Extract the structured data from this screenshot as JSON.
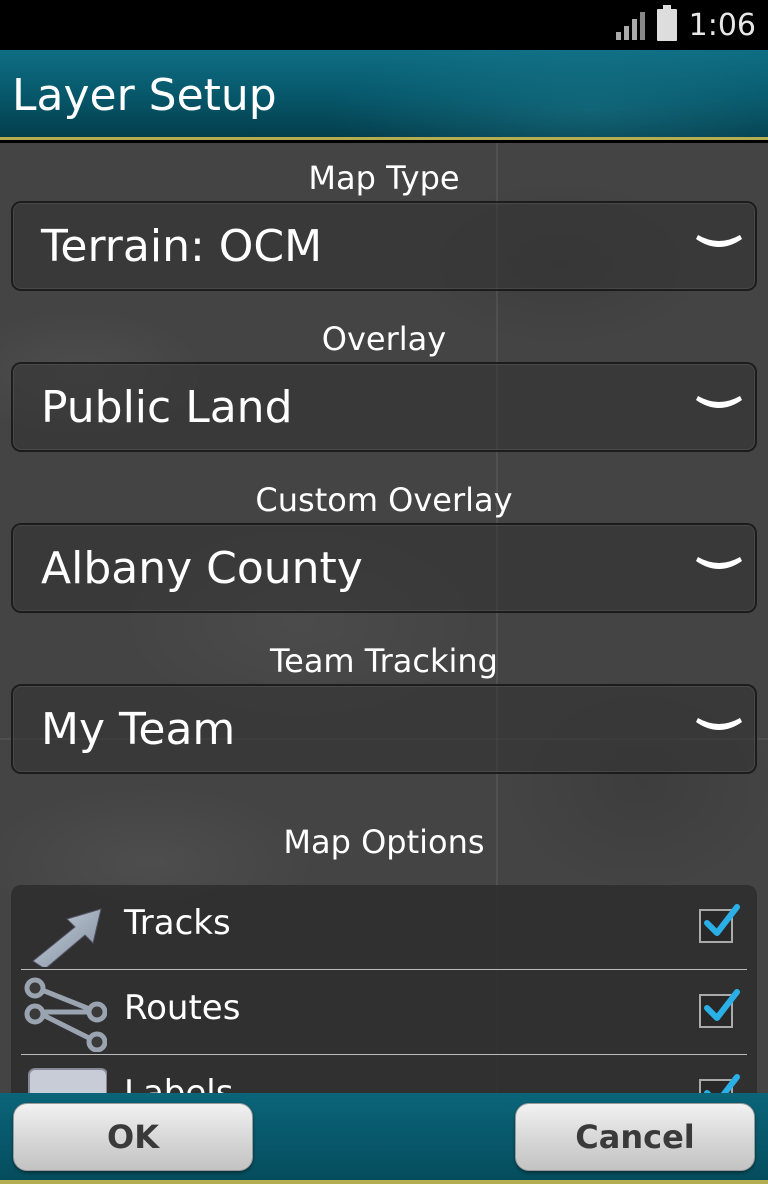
{
  "status_bar": {
    "time": "1:06"
  },
  "header": {
    "title": "Layer Setup"
  },
  "sections": [
    {
      "label": "Map Type",
      "value": "Terrain: OCM"
    },
    {
      "label": "Overlay",
      "value": "Public Land"
    },
    {
      "label": "Custom Overlay",
      "value": "Albany County"
    },
    {
      "label": "Team Tracking",
      "value": "My Team"
    }
  ],
  "map_options": {
    "title": "Map Options",
    "items": [
      {
        "label": "Tracks",
        "checked": true,
        "icon": "arrow-icon"
      },
      {
        "label": "Routes",
        "checked": true,
        "icon": "route-nodes-icon"
      },
      {
        "label": "Labels",
        "checked": true,
        "icon": "label-box-icon"
      }
    ]
  },
  "buttons": {
    "ok": "OK",
    "cancel": "Cancel"
  },
  "colors": {
    "header_bg": "#065669",
    "accent_line": "#b4ad52",
    "checkmark": "#2ab0e6",
    "content_bg": "#444444"
  }
}
